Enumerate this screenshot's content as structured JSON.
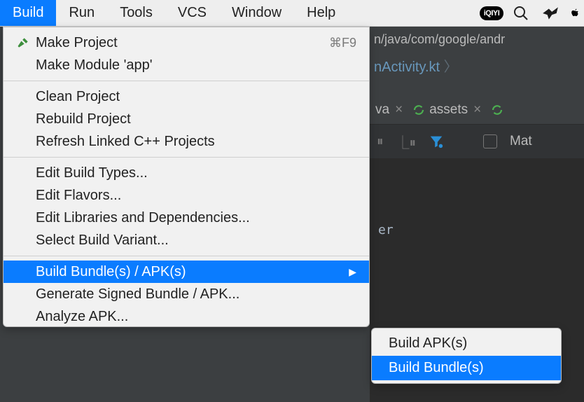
{
  "menubar": {
    "items": [
      "Build",
      "Run",
      "Tools",
      "VCS",
      "Window",
      "Help"
    ],
    "selected": "Build",
    "tray": {
      "iqiyi": "iQIYI"
    }
  },
  "dropdown": {
    "groups": [
      [
        {
          "label": "Make Project",
          "icon": "hammer",
          "shortcut": "⌘F9"
        },
        {
          "label": "Make Module 'app'"
        }
      ],
      [
        {
          "label": "Clean Project"
        },
        {
          "label": "Rebuild Project"
        },
        {
          "label": "Refresh Linked C++ Projects"
        }
      ],
      [
        {
          "label": "Edit Build Types..."
        },
        {
          "label": "Edit Flavors..."
        },
        {
          "label": "Edit Libraries and Dependencies..."
        },
        {
          "label": "Select Build Variant..."
        }
      ],
      [
        {
          "label": "Build Bundle(s) / APK(s)",
          "submenu": true,
          "highlight": true
        },
        {
          "label": "Generate Signed Bundle / APK..."
        },
        {
          "label": "Analyze APK..."
        }
      ]
    ]
  },
  "submenu": {
    "items": [
      {
        "label": "Build APK(s)"
      },
      {
        "label": "Build Bundle(s)",
        "highlight": true
      }
    ]
  },
  "editor": {
    "path_fragment": "n/java/com/google/andr",
    "file_crumb": "nActivity.kt",
    "tabs": {
      "left_fragment": "va",
      "asset_tab": "assets"
    },
    "toolbar": {
      "match_fragment": "Mat"
    },
    "body_fragment": "er"
  }
}
